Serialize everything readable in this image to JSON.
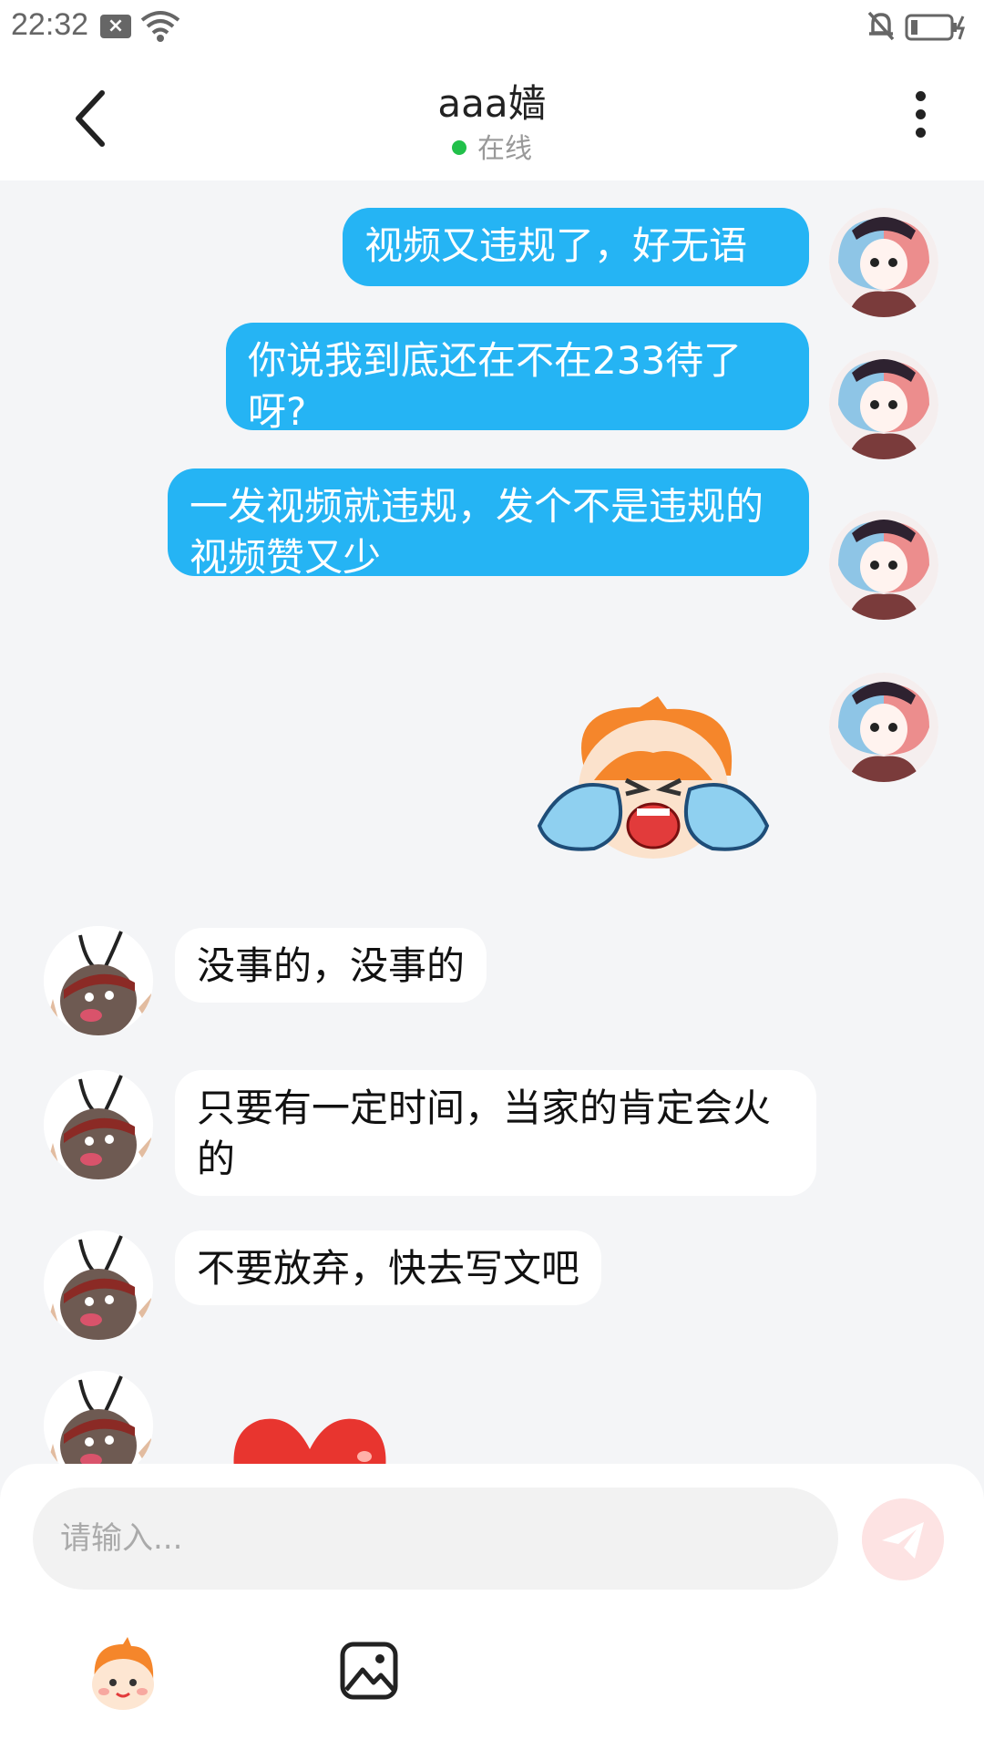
{
  "statusbar": {
    "time": "22:32"
  },
  "header": {
    "back": "返回",
    "title": "aaa嫱",
    "status": "在线",
    "status_color": "#21c04a"
  },
  "messages": [
    {
      "side": "me",
      "text": "视频又违规了，好无语"
    },
    {
      "side": "me",
      "text": "你说我到底还在不在233待了呀?"
    },
    {
      "side": "me",
      "text": "一发视频就违规，发个不是违规的视频赞又少"
    },
    {
      "side": "me",
      "sticker": "crying-sticker"
    },
    {
      "side": "other",
      "text": "没事的，没事的"
    },
    {
      "side": "other",
      "text": "只要有一定时间，当家的肯定会火的"
    },
    {
      "side": "other",
      "text": "不要放弃，快去写文吧"
    },
    {
      "side": "other",
      "sticker": "heart-sticker"
    }
  ],
  "composer": {
    "placeholder": "请输入..."
  },
  "colors": {
    "my_bubble": "#25b4f4",
    "other_bubble": "#ffffff",
    "background": "#f4f5f7"
  }
}
